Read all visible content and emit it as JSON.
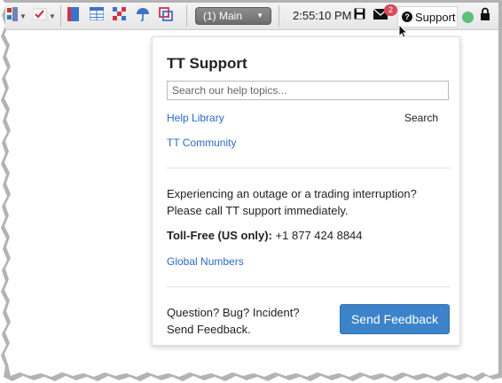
{
  "toolbar": {
    "layout_selector": "(1) Main",
    "clock": "2:55:10 PM",
    "messages_badge": "2",
    "support_label": "Support",
    "status_color": "#5cbf7a",
    "icons": [
      "layout-icon",
      "checkmark-icon",
      "book-icon",
      "grid-icon",
      "pattern-icon",
      "umbrella-icon",
      "window-icon",
      "save-icon",
      "envelope-icon",
      "question-icon",
      "lock-icon"
    ]
  },
  "support_panel": {
    "title": "TT Support",
    "search_placeholder": "Search our help topics...",
    "search_label": "Search",
    "links": {
      "help_library": "Help Library",
      "community": "TT Community",
      "global_numbers": "Global Numbers"
    },
    "outage_line1": "Experiencing an outage or a trading interruption?",
    "outage_line2": "Please call TT support immediately.",
    "tollfree_label": "Toll-Free (US only):",
    "tollfree_number": " +1 877 424 8844",
    "feedback_line1": "Question? Bug? Incident?",
    "feedback_line2": "Send Feedback.",
    "feedback_button": "Send Feedback"
  },
  "colors": {
    "accent": "#3c83c9",
    "link": "#2b6cc4",
    "badge": "#d64a5a"
  }
}
